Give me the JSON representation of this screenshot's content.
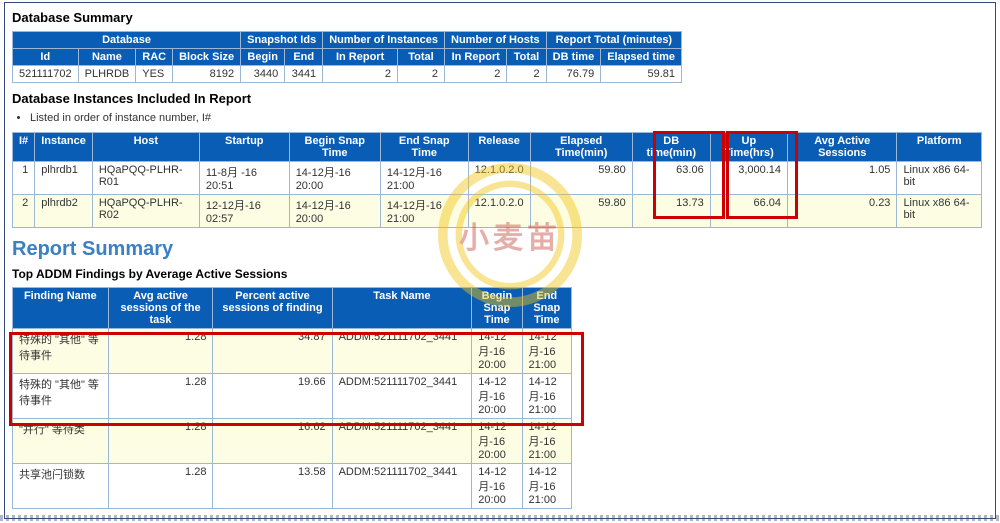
{
  "headings": {
    "dbSummary": "Database Summary",
    "instancesIncluded": "Database Instances Included In Report",
    "instOrderNote": "Listed in order of instance number, I#",
    "reportSummary": "Report Summary",
    "topAddm": "Top ADDM Findings by Average Active Sessions"
  },
  "dbSummary": {
    "groupHeaders": {
      "database": "Database",
      "snapshotIds": "Snapshot Ids",
      "numInstances": "Number of Instances",
      "numHosts": "Number of Hosts",
      "reportTotal": "Report Total (minutes)"
    },
    "cols": {
      "id": "Id",
      "name": "Name",
      "rac": "RAC",
      "blockSize": "Block Size",
      "begin": "Begin",
      "end": "End",
      "inReportI": "In Report",
      "totalI": "Total",
      "inReportH": "In Report",
      "totalH": "Total",
      "dbTime": "DB time",
      "elapsed": "Elapsed time"
    },
    "row": {
      "id": "521111702",
      "name": "PLHRDB",
      "rac": "YES",
      "blockSize": "8192",
      "begin": "3440",
      "end": "3441",
      "inReportI": "2",
      "totalI": "2",
      "inReportH": "2",
      "totalH": "2",
      "dbTime": "76.79",
      "elapsed": "59.81"
    }
  },
  "instances": {
    "cols": {
      "iNum": "I#",
      "instance": "Instance",
      "host": "Host",
      "startup": "Startup",
      "beginSnap": "Begin Snap Time",
      "endSnap": "End Snap Time",
      "release": "Release",
      "elapsedMin": "Elapsed Time(min)",
      "dbTimeMin": "DB time(min)",
      "upTimeHrs": "Up Time(hrs)",
      "avgActive": "Avg Active Sessions",
      "platform": "Platform"
    },
    "rows": [
      {
        "iNum": "1",
        "instance": "plhrdb1",
        "host": "HQaPQQ-PLHR-R01",
        "startup": "11-8月 -16 20:51",
        "beginSnap": "14-12月-16 20:00",
        "endSnap": "14-12月-16 21:00",
        "release": "12.1.0.2.0",
        "elapsedMin": "59.80",
        "dbTimeMin": "63.06",
        "upTimeHrs": "3,000.14",
        "avgActive": "1.05",
        "platform": "Linux x86 64-bit"
      },
      {
        "iNum": "2",
        "instance": "plhrdb2",
        "host": "HQaPQQ-PLHR-R02",
        "startup": "12-12月-16 02:57",
        "beginSnap": "14-12月-16 20:00",
        "endSnap": "14-12月-16 21:00",
        "release": "12.1.0.2.0",
        "elapsedMin": "59.80",
        "dbTimeMin": "13.73",
        "upTimeHrs": "66.04",
        "avgActive": "0.23",
        "platform": "Linux x86 64-bit"
      }
    ]
  },
  "addm": {
    "cols": {
      "finding": "Finding Name",
      "avgActive": "Avg active sessions of the task",
      "pctActive": "Percent active sessions of finding",
      "taskName": "Task Name",
      "beginSnap": "Begin Snap Time",
      "endSnap": "End Snap Time"
    },
    "rows": [
      {
        "finding": "特殊的 \"其他\" 等待事件",
        "avgActive": "1.28",
        "pctActive": "34.87",
        "taskName": "ADDM:521111702_3441",
        "beginSnap": "14-12月-16 20:00",
        "endSnap": "14-12月-16 21:00"
      },
      {
        "finding": "特殊的 \"其他\" 等待事件",
        "avgActive": "1.28",
        "pctActive": "19.66",
        "taskName": "ADDM:521111702_3441",
        "beginSnap": "14-12月-16 20:00",
        "endSnap": "14-12月-16 21:00"
      },
      {
        "finding": "\"并行\" 等待类",
        "avgActive": "1.28",
        "pctActive": "16.62",
        "taskName": "ADDM:521111702_3441",
        "beginSnap": "14-12月-16 20:00",
        "endSnap": "14-12月-16 21:00"
      },
      {
        "finding": "共享池闩锁数",
        "avgActive": "1.28",
        "pctActive": "13.58",
        "taskName": "ADDM:521111702_3441",
        "beginSnap": "14-12月-16 20:00",
        "endSnap": "14-12月-16 21:00"
      }
    ]
  },
  "watermark": {
    "text": "小麦苗"
  }
}
